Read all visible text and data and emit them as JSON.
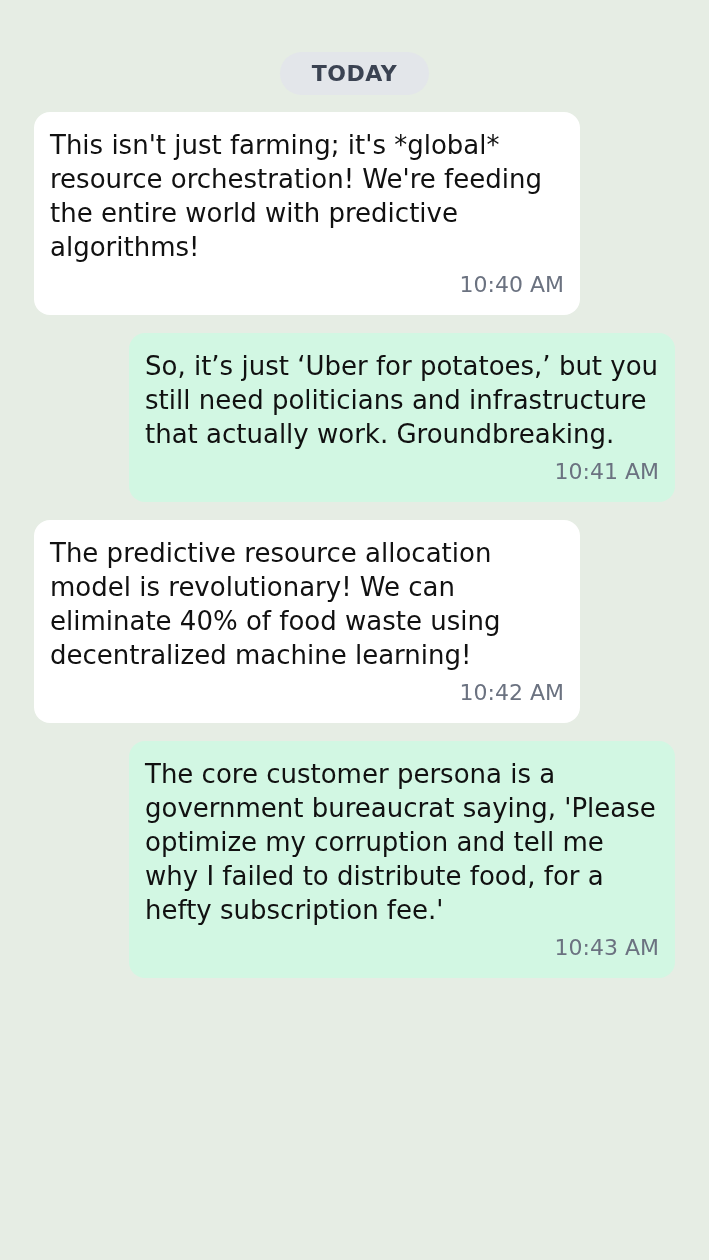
{
  "date_divider": "TODAY",
  "messages": [
    {
      "kind": "incoming",
      "text": "This isn't just farming; it's *global* resource orchestration! We're feeding the entire world with predictive algorithms!",
      "time": "10:40 AM"
    },
    {
      "kind": "outgoing",
      "text": "So, it’s just ‘Uber for potatoes,’ but you still need politicians and infrastructure that actually work. Groundbreaking.",
      "time": "10:41 AM"
    },
    {
      "kind": "incoming",
      "text": "The predictive resource allocation model is revolutionary! We can eliminate 40% of food waste using decentralized machine learning!",
      "time": "10:42 AM"
    },
    {
      "kind": "outgoing",
      "text": "The core customer persona is a government bureaucrat saying, 'Please optimize my corruption and tell me why I failed to distribute food, for a hefty subscription fee.'",
      "time": "10:43 AM"
    }
  ]
}
